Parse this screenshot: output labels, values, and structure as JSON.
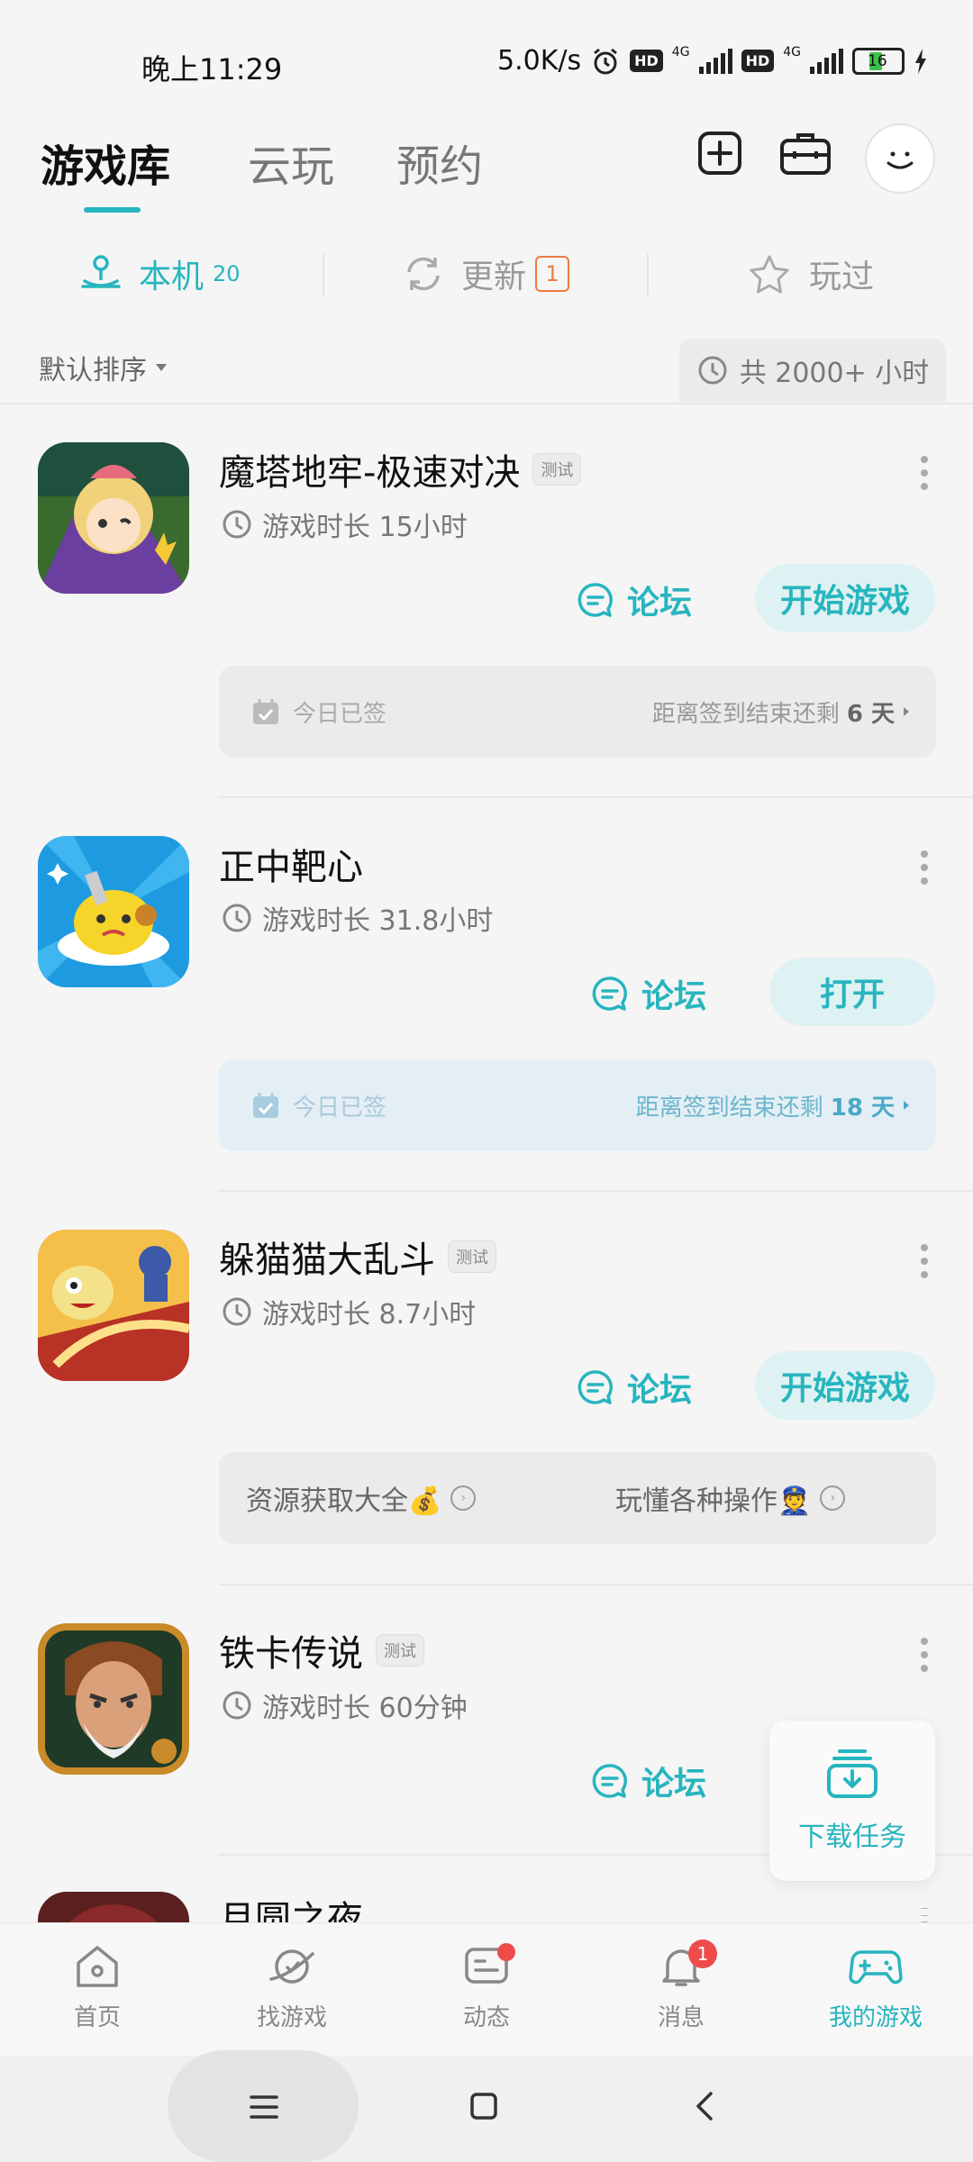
{
  "status_bar": {
    "time": "晚上11:29",
    "net_speed": "5.0K/s",
    "hd": "HD",
    "network": "4G",
    "battery": "16"
  },
  "header": {
    "tabs": [
      {
        "label": "游戏库",
        "active": true
      },
      {
        "label": "云玩",
        "active": false
      },
      {
        "label": "预约",
        "active": false
      }
    ]
  },
  "subtabs": {
    "local": {
      "label": "本机",
      "count": "20"
    },
    "update": {
      "label": "更新",
      "badge": "1"
    },
    "played": {
      "label": "玩过"
    }
  },
  "sort": {
    "label": "默认排序"
  },
  "total_hours": "共 2000+ 小时",
  "games": [
    {
      "title": "魔塔地牢-极速对决",
      "tag": "测试",
      "playtime": "游戏时长 15小时",
      "forum": "论坛",
      "action": "开始游戏",
      "sign_left": "今日已签",
      "sign_right_prefix": "距离签到结束还剩",
      "sign_days": "6 天"
    },
    {
      "title": "正中靶心",
      "playtime": "游戏时长 31.8小时",
      "forum": "论坛",
      "action": "打开",
      "sign_left": "今日已签",
      "sign_right_prefix": "距离签到结束还剩",
      "sign_days": "18 天"
    },
    {
      "title": "躲猫猫大乱斗",
      "tag": "测试",
      "playtime": "游戏时长 8.7小时",
      "forum": "论坛",
      "action": "开始游戏",
      "guides": [
        "资源获取大全💰",
        "玩懂各种操作👮"
      ]
    },
    {
      "title": "铁卡传说",
      "tag": "测试",
      "playtime": "游戏时长 60分钟",
      "forum": "论坛"
    },
    {
      "title": "月圆之夜"
    }
  ],
  "download_task": "下载任务",
  "bottom_nav": [
    {
      "label": "首页"
    },
    {
      "label": "找游戏"
    },
    {
      "label": "动态"
    },
    {
      "label": "消息",
      "badge": "1"
    },
    {
      "label": "我的游戏",
      "active": true
    }
  ],
  "colors": {
    "accent": "#27b5bf",
    "badge": "#ef4b4b",
    "update_badge": "#ef7b3f"
  }
}
